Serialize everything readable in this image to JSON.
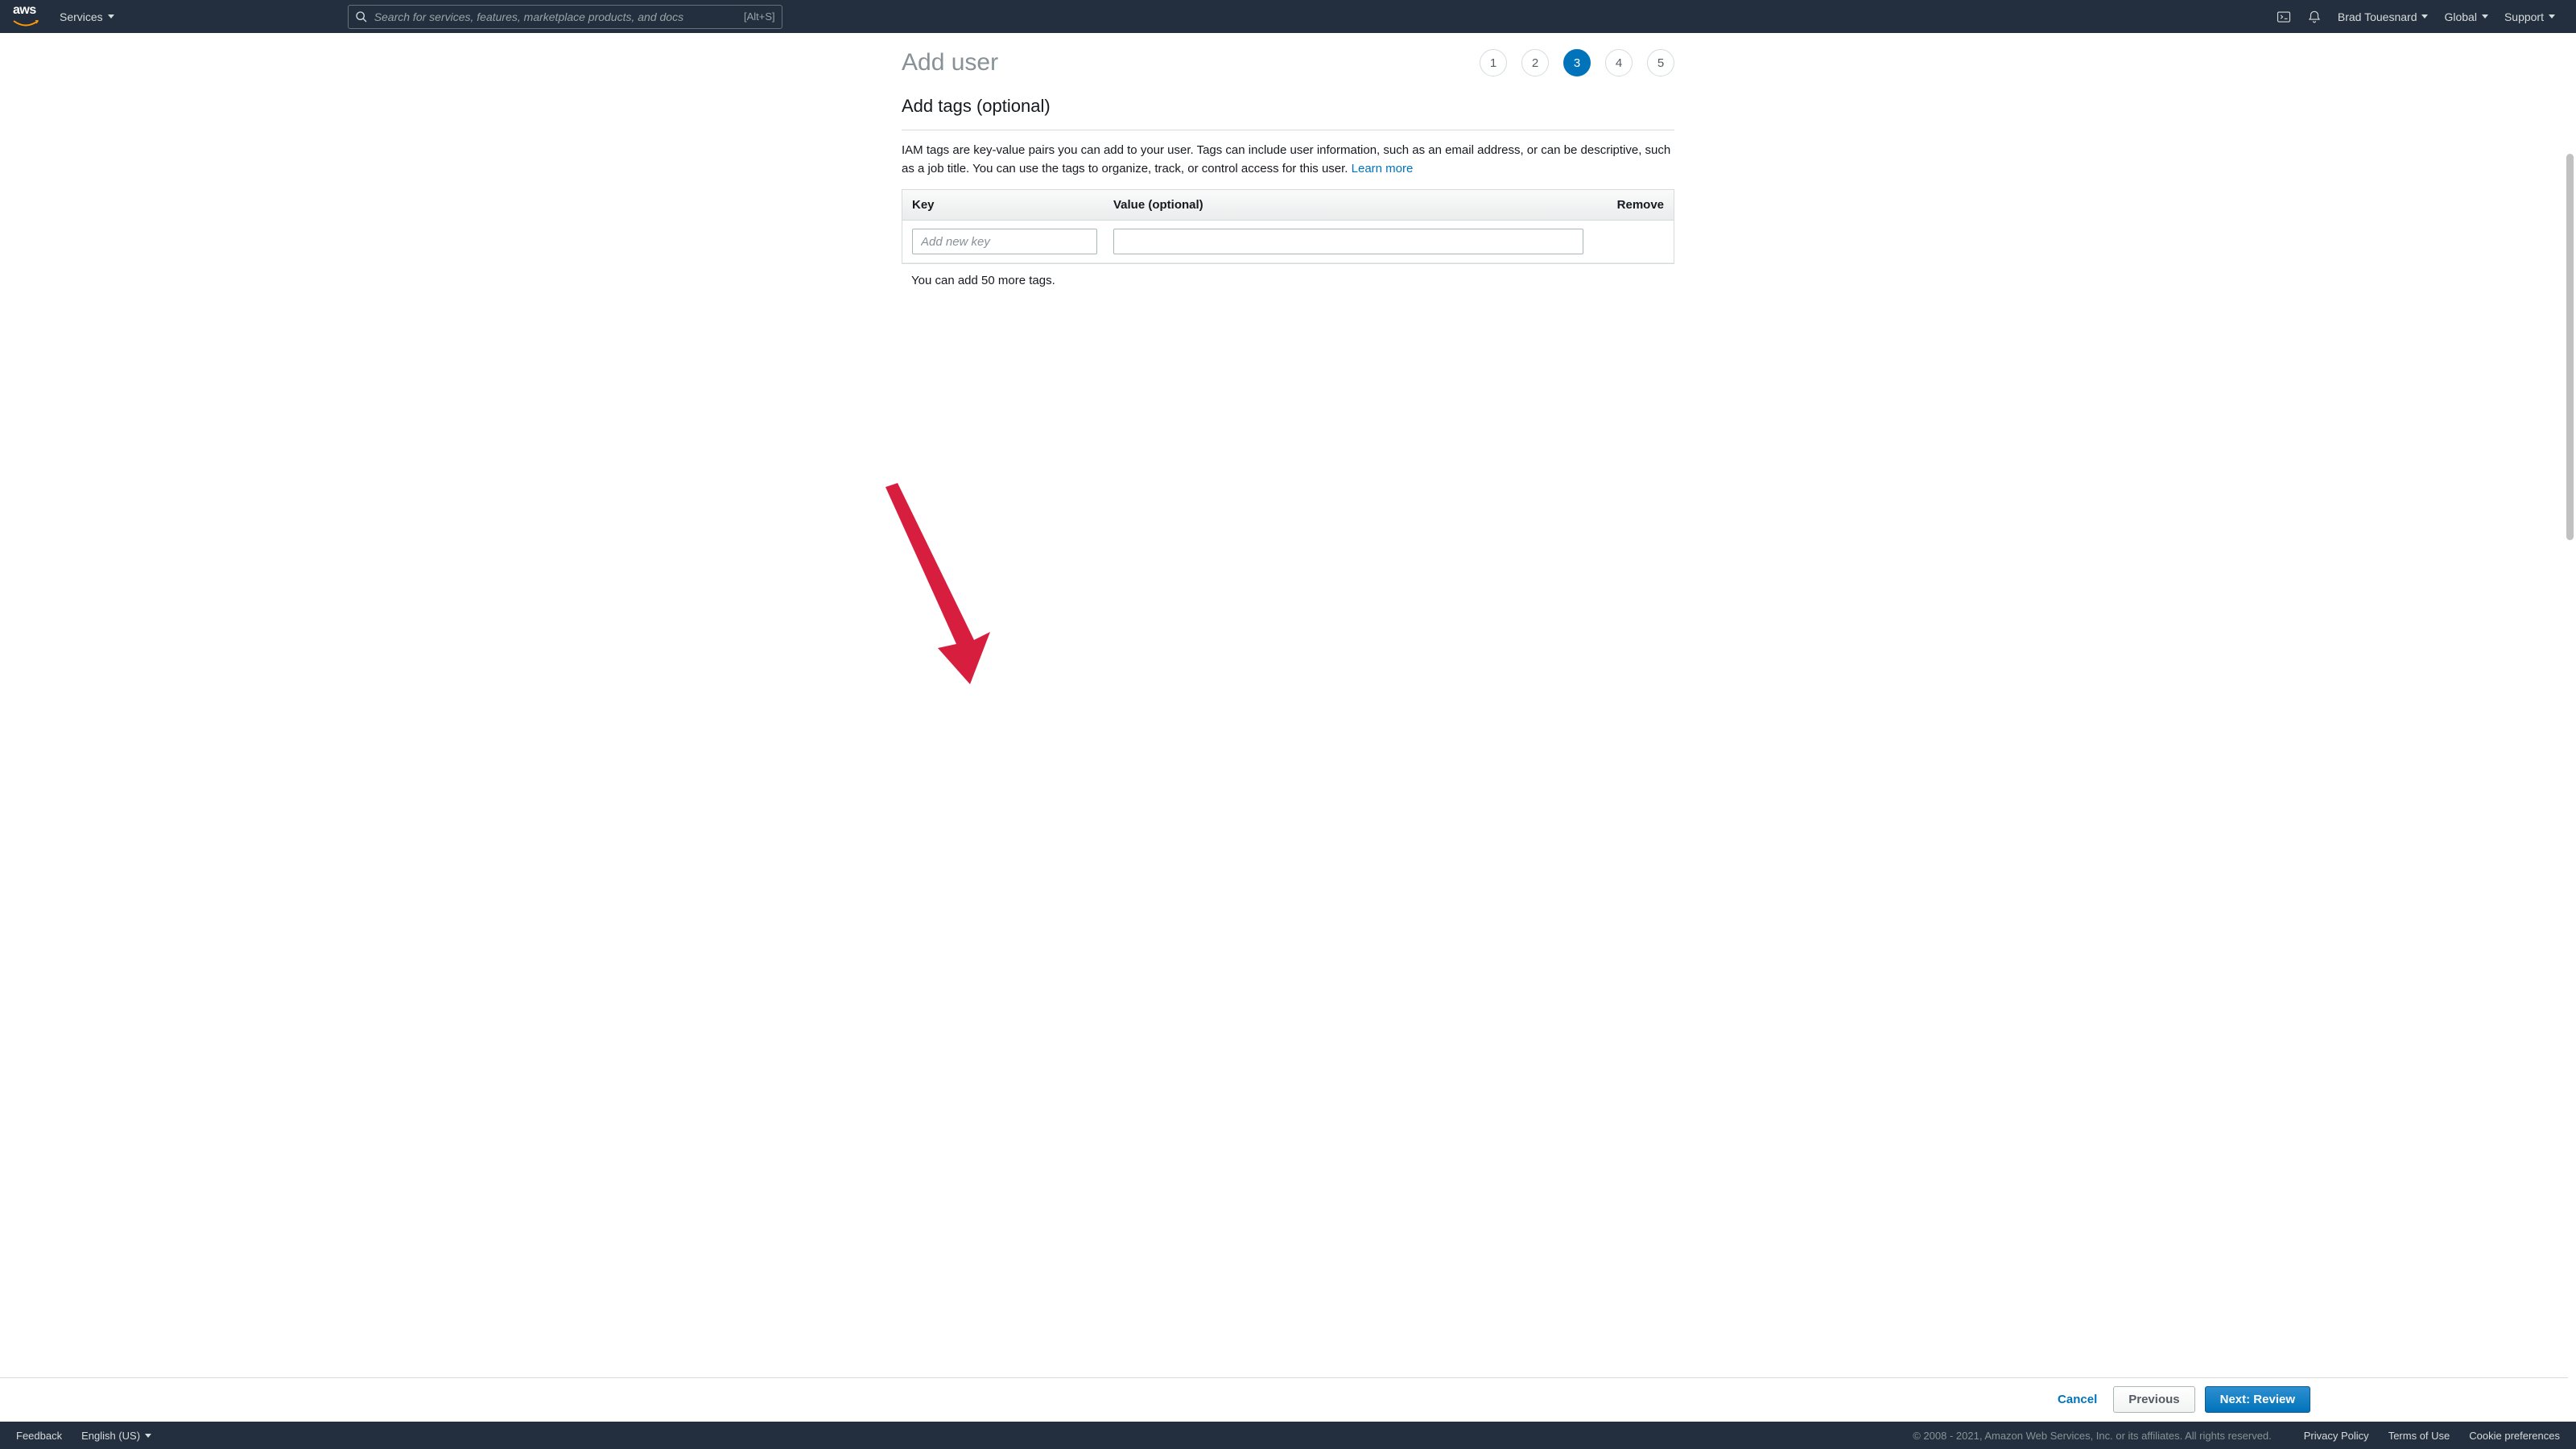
{
  "nav": {
    "services": "Services",
    "search_placeholder": "Search for services, features, marketplace products, and docs",
    "search_shortcut": "[Alt+S]",
    "user": "Brad Touesnard",
    "region": "Global",
    "support": "Support"
  },
  "page": {
    "title": "Add user",
    "steps": [
      "1",
      "2",
      "3",
      "4",
      "5"
    ],
    "active_step": 3,
    "section_title": "Add tags (optional)",
    "description": "IAM tags are key-value pairs you can add to your user. Tags can include user information, such as an email address, or can be descriptive, such as a job title. You can use the tags to organize, track, or control access for this user. ",
    "learn_more": "Learn more",
    "table": {
      "col_key": "Key",
      "col_value": "Value (optional)",
      "col_remove": "Remove",
      "key_placeholder": "Add new key",
      "value_placeholder": ""
    },
    "remaining": "You can add 50 more tags."
  },
  "actions": {
    "cancel": "Cancel",
    "previous": "Previous",
    "next": "Next: Review"
  },
  "footer": {
    "feedback": "Feedback",
    "language": "English (US)",
    "copyright": "© 2008 - 2021, Amazon Web Services, Inc. or its affiliates. All rights reserved.",
    "privacy": "Privacy Policy",
    "terms": "Terms of Use",
    "cookies": "Cookie preferences"
  }
}
